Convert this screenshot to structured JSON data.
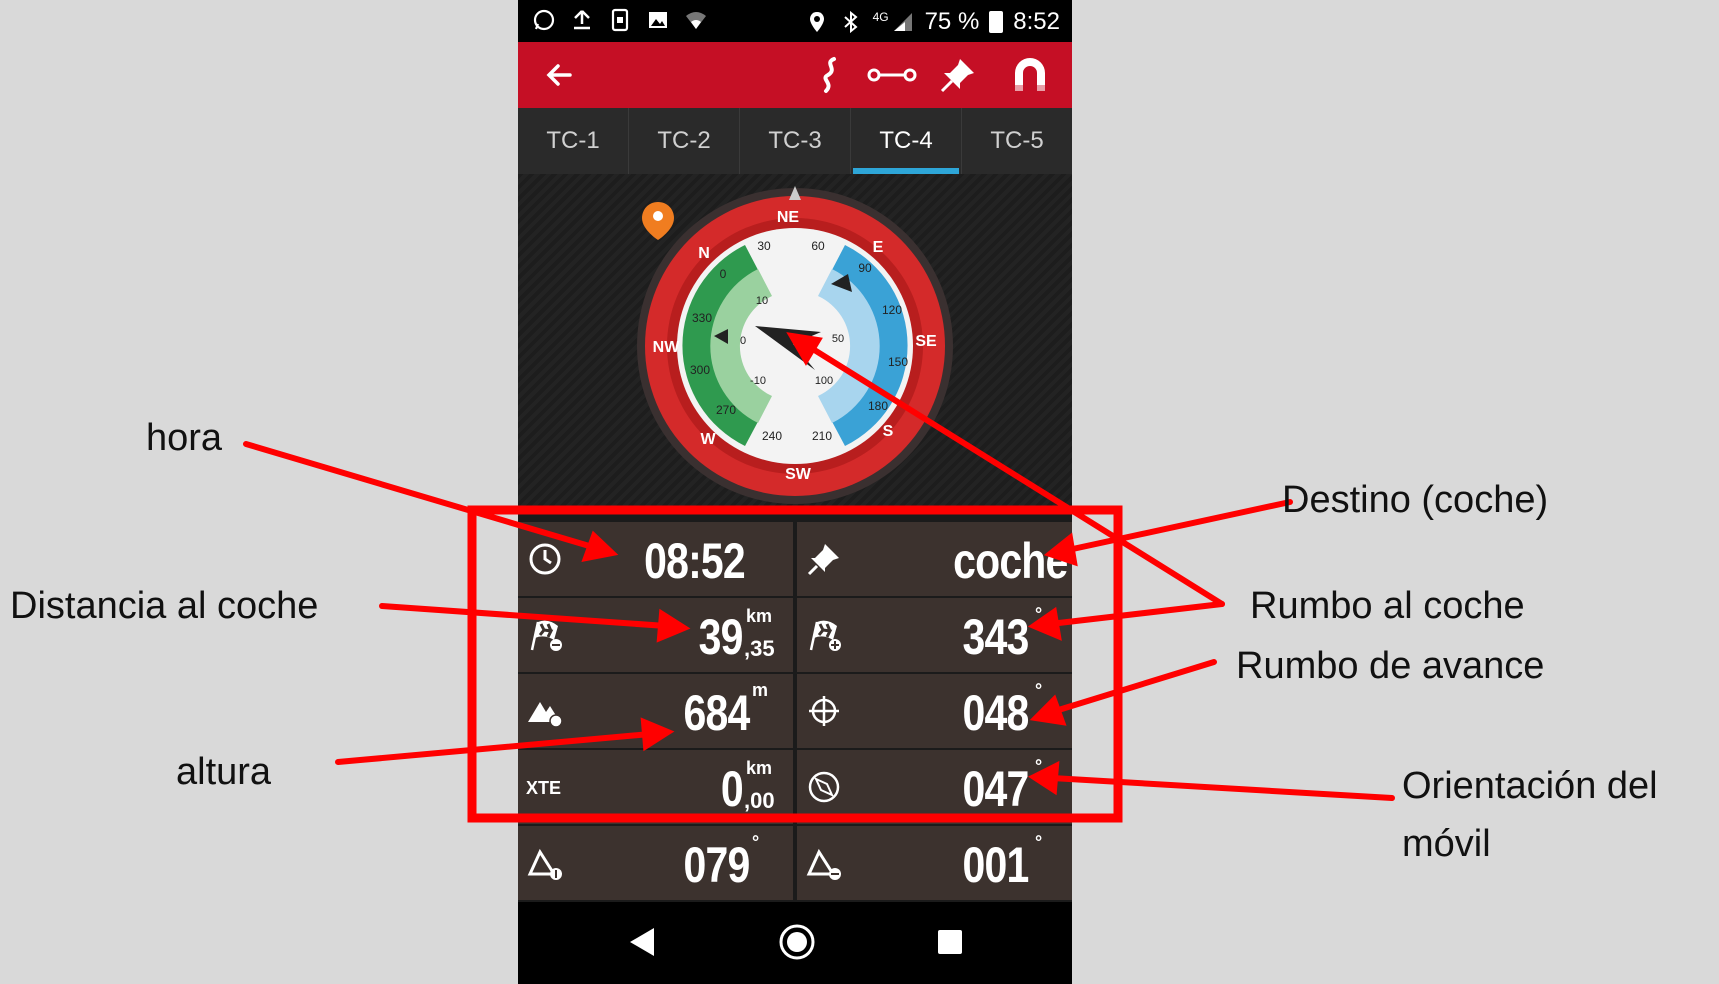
{
  "status_bar": {
    "battery": "75 %",
    "time": "8:52",
    "network": "4G",
    "left_icons": [
      "whatsapp-icon",
      "upload-icon",
      "phone-lock-icon",
      "image-icon",
      "wifi-icon"
    ],
    "right_icons": [
      "location-pin-icon",
      "bluetooth-icon",
      "signal-icon",
      "battery-icon"
    ]
  },
  "app_bar": {
    "icons": [
      "back-arrow-icon",
      "route-icon",
      "segment-icon",
      "pushpin-icon",
      "magnet-icon"
    ],
    "color": "#c50f25"
  },
  "tabs": [
    {
      "label": "TC-1",
      "active": false
    },
    {
      "label": "TC-2",
      "active": false
    },
    {
      "label": "TC-3",
      "active": false
    },
    {
      "label": "TC-4",
      "active": true
    },
    {
      "label": "TC-5",
      "active": false
    }
  ],
  "compass": {
    "cardinals": [
      "N",
      "NE",
      "E",
      "SE",
      "S",
      "SW",
      "W",
      "NW"
    ],
    "degrees": [
      "0",
      "30",
      "60",
      "90",
      "120",
      "150",
      "180",
      "210",
      "240",
      "270",
      "300",
      "330"
    ],
    "left_scale": [
      "10",
      "0",
      "-10"
    ],
    "right_scale": [
      "50",
      "100"
    ],
    "green_color": "#2f9a4f",
    "blue_color": "#3aa2d6",
    "ring_color": "#d42a2a"
  },
  "fields": {
    "time": {
      "value": "08:52",
      "icon": "clock-icon"
    },
    "destination": {
      "value": "coche",
      "icon": "pushpin-icon"
    },
    "distance": {
      "int": "39",
      "dec": ",35",
      "unit": "km",
      "icon": "finish-flag-minus-icon"
    },
    "bearing": {
      "value": "343",
      "unit": "°",
      "icon": "finish-flag-plus-icon"
    },
    "altitude": {
      "value": "684",
      "unit": "m",
      "icon": "mountain-icon"
    },
    "course": {
      "value": "048",
      "unit": "°",
      "icon": "crosshair-icon"
    },
    "xte": {
      "label": "XTE",
      "int": "0",
      "dec": ",00",
      "unit": "km"
    },
    "heading": {
      "value": "047",
      "unit": "°",
      "icon": "compass-icon"
    },
    "ascent_a": {
      "value": "079",
      "unit": "°",
      "icon": "slope-up-icon"
    },
    "ascent_b": {
      "value": "001",
      "unit": "°",
      "icon": "slope-down-icon"
    }
  },
  "nav_bar": {
    "icons": [
      "back-triangle-icon",
      "home-circle-icon",
      "recents-square-icon"
    ]
  },
  "annotations": {
    "hora": "hora",
    "distancia": "Distancia al coche",
    "altura": "altura",
    "destino": "Destino (coche)",
    "rumbo_coche": "Rumbo al coche",
    "rumbo_avance": "Rumbo de avance",
    "orientacion_1": "Orientación del",
    "orientacion_2": "móvil",
    "color": "#ff0000"
  }
}
